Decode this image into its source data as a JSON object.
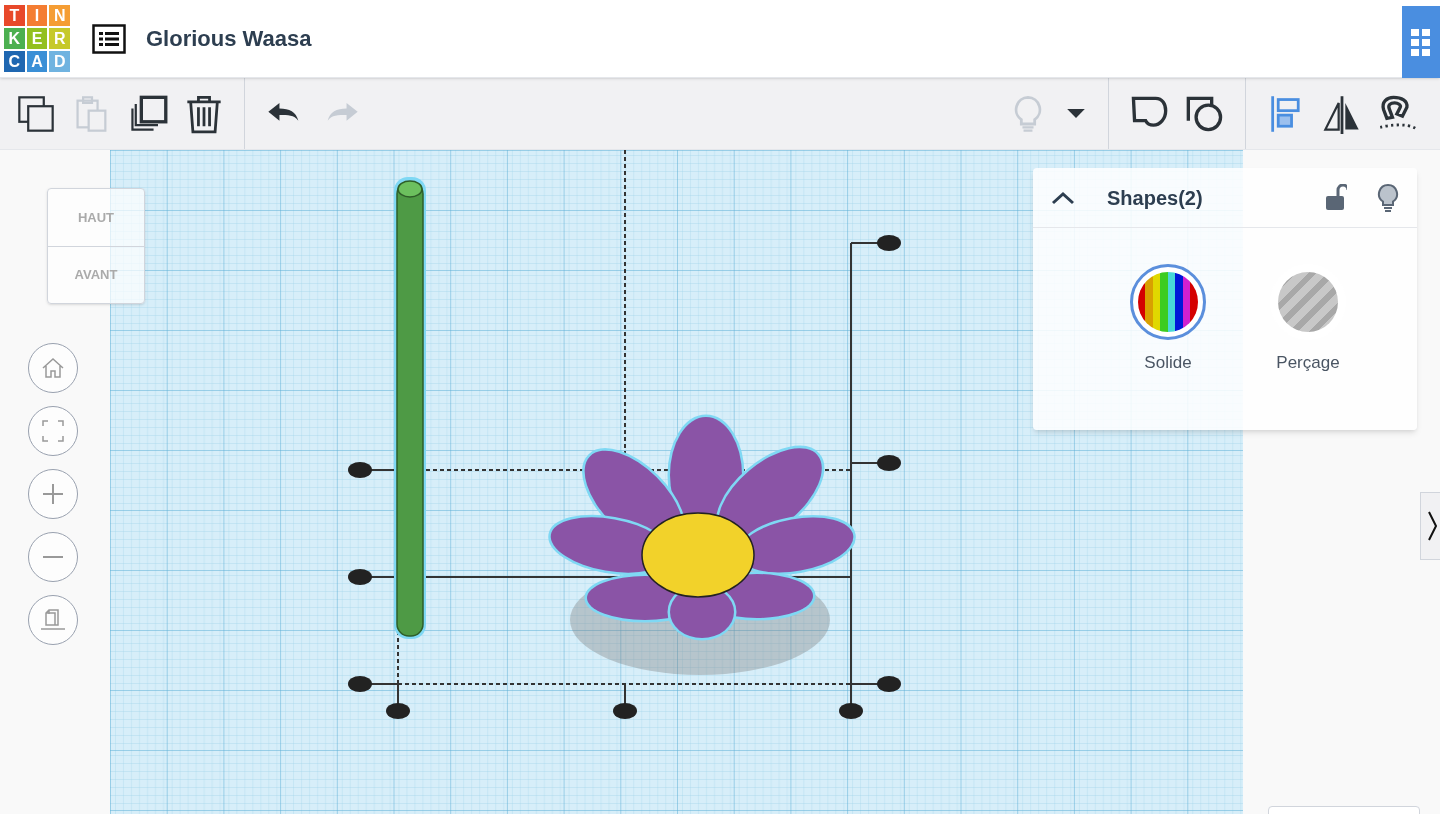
{
  "logo": [
    {
      "char": "T",
      "color": "#e8492a"
    },
    {
      "char": "I",
      "color": "#f47d32"
    },
    {
      "char": "N",
      "color": "#f59d33"
    },
    {
      "char": "K",
      "color": "#4cb050"
    },
    {
      "char": "E",
      "color": "#93c01f"
    },
    {
      "char": "R",
      "color": "#c6c92a"
    },
    {
      "char": "C",
      "color": "#1f67b1"
    },
    {
      "char": "A",
      "color": "#3a8fd6"
    },
    {
      "char": "D",
      "color": "#70b3e0"
    }
  ],
  "project_title": "Glorious Waasa",
  "toolbar": [
    {
      "kind": "copy",
      "disabled": false
    },
    {
      "kind": "paste",
      "disabled": true
    },
    {
      "kind": "duplicate",
      "disabled": false
    },
    {
      "kind": "delete",
      "disabled": false
    },
    {
      "kind": "separator"
    },
    {
      "kind": "undo",
      "disabled": false
    },
    {
      "kind": "redo",
      "disabled": true
    }
  ],
  "toolbar_right": [
    {
      "kind": "bulb",
      "disabled": true
    },
    {
      "kind": "dropdown",
      "disabled": false
    },
    {
      "kind": "separator"
    },
    {
      "kind": "group",
      "disabled": false
    },
    {
      "kind": "ungroup",
      "disabled": false
    },
    {
      "kind": "separator"
    },
    {
      "kind": "align",
      "disabled": false
    },
    {
      "kind": "mirror",
      "disabled": false
    },
    {
      "kind": "magnet",
      "disabled": false
    }
  ],
  "view_cube": {
    "top": "HAUT",
    "front": "AVANT"
  },
  "shapes_panel": {
    "title": "Shapes(2)",
    "options": [
      {
        "label": "Solide",
        "kind": "solid",
        "selected": true
      },
      {
        "label": "Perçage",
        "kind": "hole",
        "selected": false
      }
    ]
  }
}
